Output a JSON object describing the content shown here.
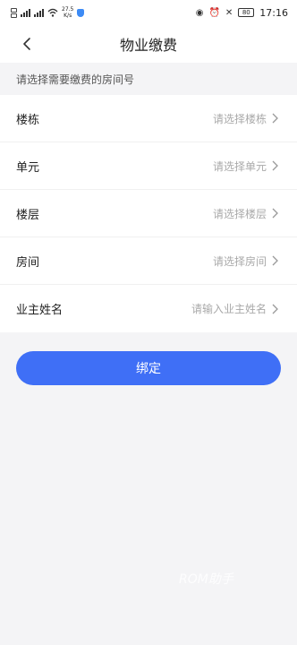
{
  "status_bar": {
    "network_speed_value": "27.5",
    "network_speed_unit": "K/s",
    "battery_level": "80",
    "time": "17:16"
  },
  "nav": {
    "title": "物业缴费"
  },
  "form": {
    "hint": "请选择需要缴费的房间号",
    "rows": [
      {
        "label": "楼栋",
        "placeholder": "请选择楼栋"
      },
      {
        "label": "单元",
        "placeholder": "请选择单元"
      },
      {
        "label": "楼层",
        "placeholder": "请选择楼层"
      },
      {
        "label": "房间",
        "placeholder": "请选择房间"
      },
      {
        "label": "业主姓名",
        "placeholder": "请输入业主姓名"
      }
    ]
  },
  "actions": {
    "bind_label": "绑定"
  },
  "watermark": "ROM助手",
  "colors": {
    "accent": "#3f6ff6",
    "background": "#f4f4f6",
    "placeholder": "#a9a9a9"
  }
}
